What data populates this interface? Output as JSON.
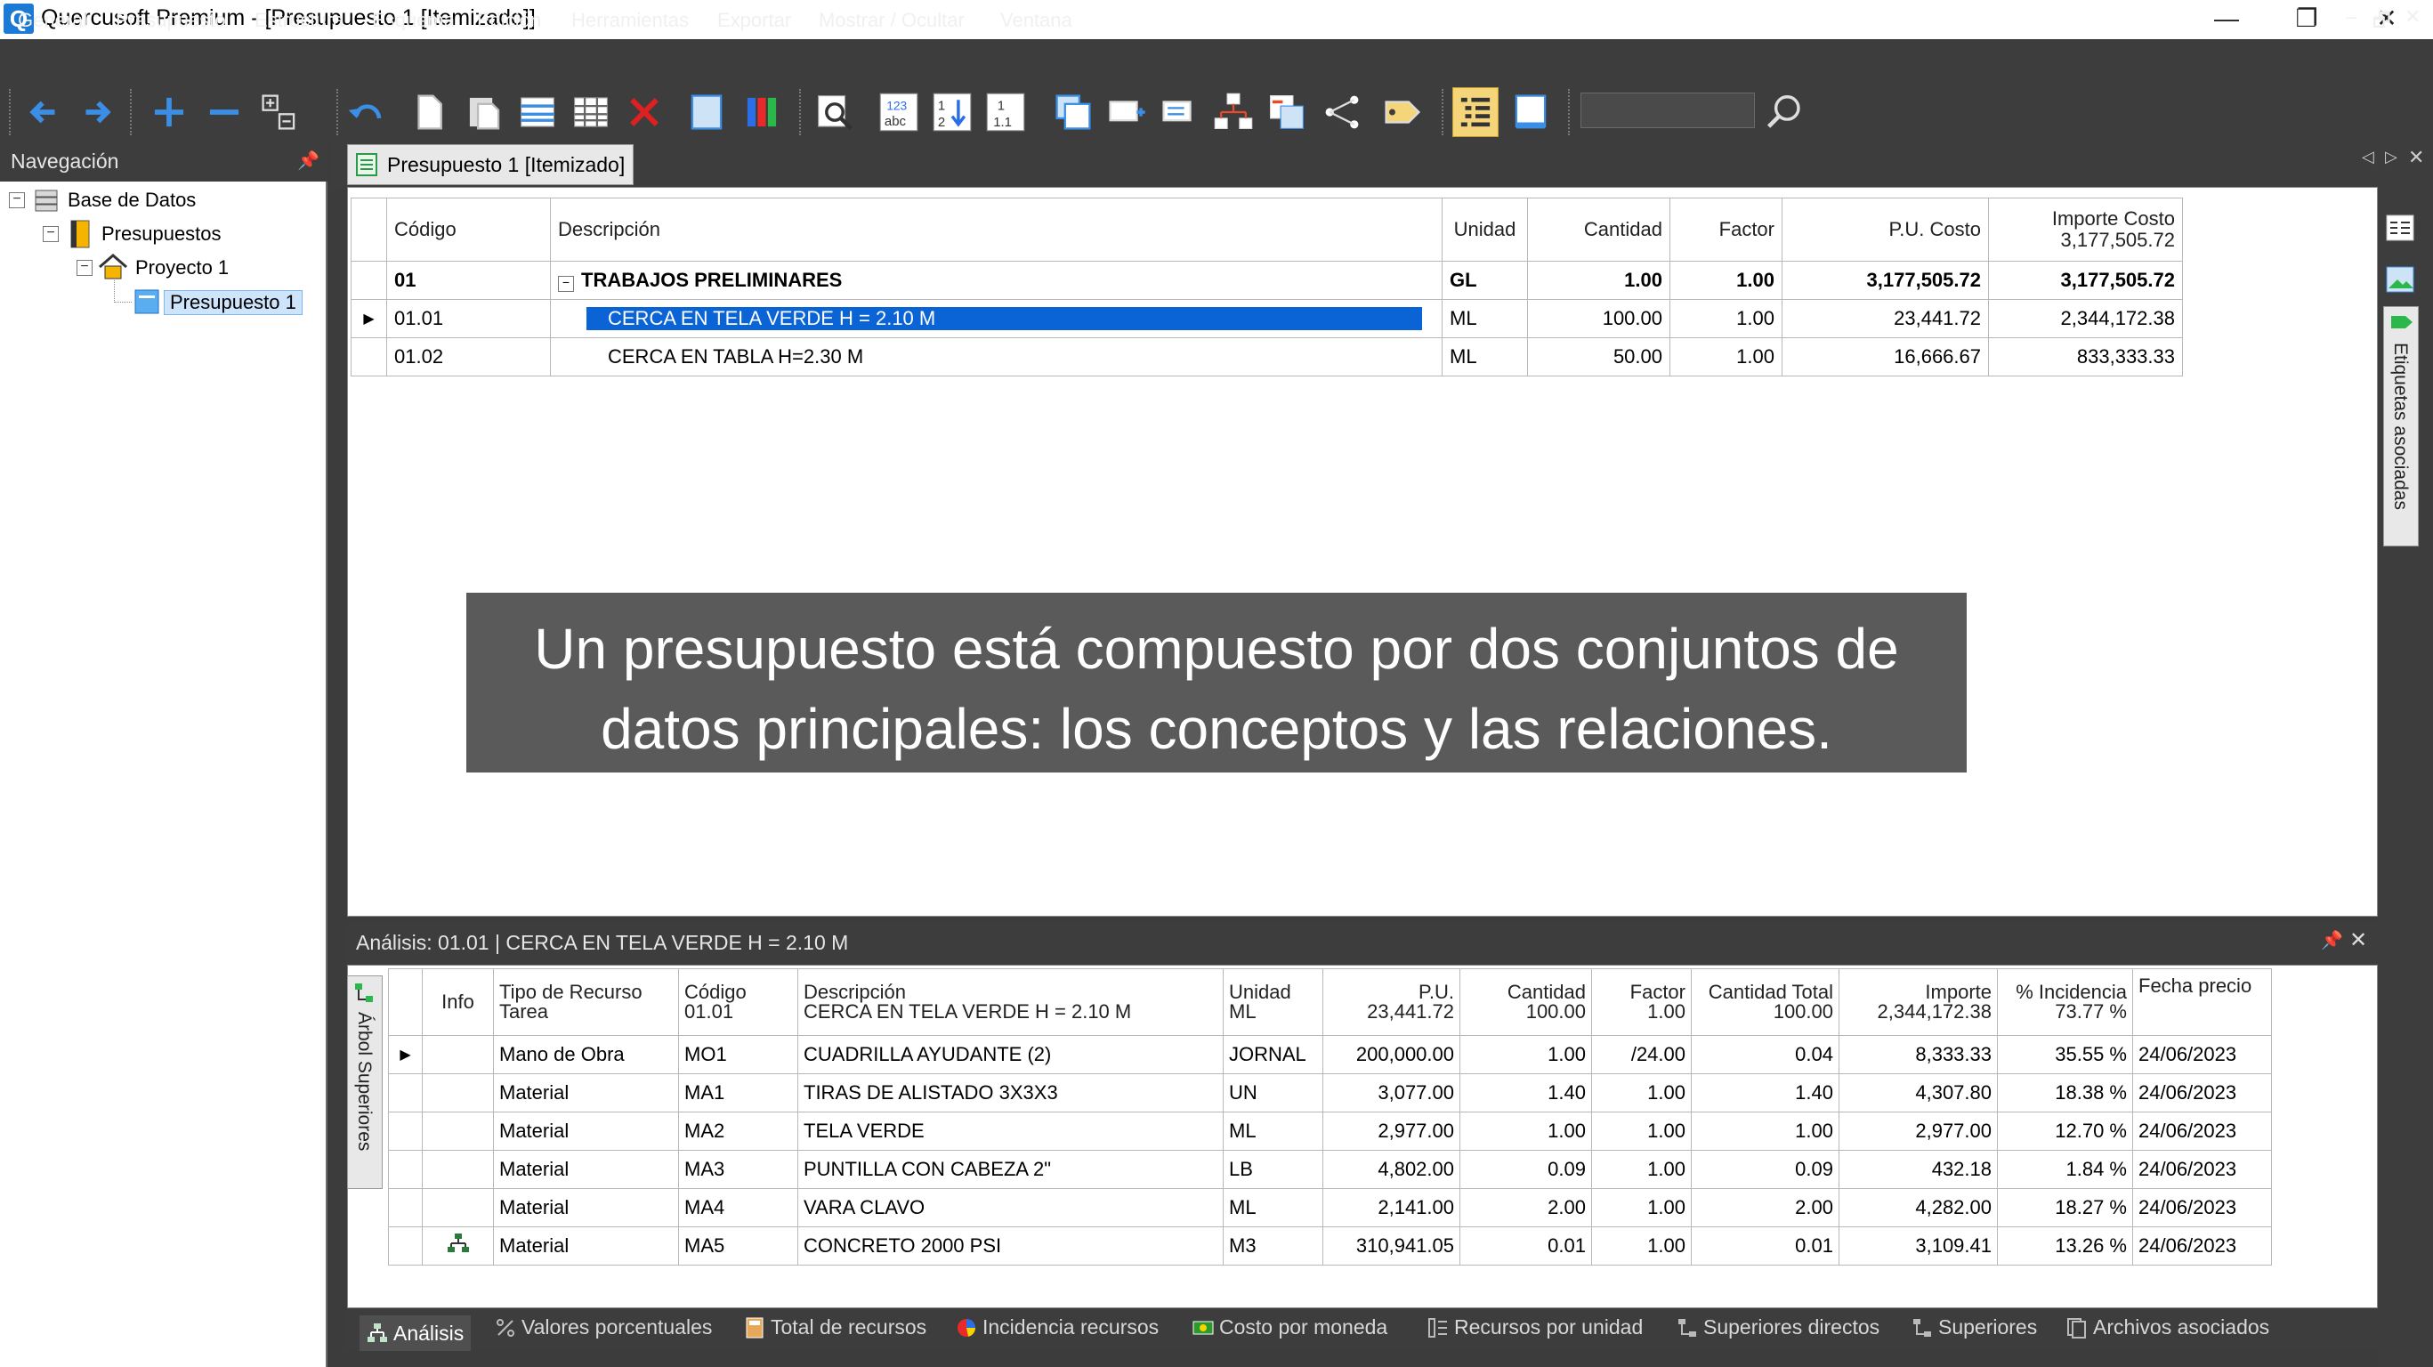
{
  "window": {
    "title": "Quercusoft Premium - [Presupuesto 1 [Itemizado]]",
    "icon_letter": "Q",
    "min": "—",
    "restore": "❐",
    "close": "✕"
  },
  "menu": [
    "General",
    "Presupuesto",
    "Estructura",
    "Esquema",
    "Edición",
    "Herramientas",
    "Exportar",
    "Mostrar / Ocultar",
    "Ventana"
  ],
  "mdi": {
    "min": "–",
    "restore": "🗗",
    "close": "✕"
  },
  "toolbar": {
    "buttons": [
      "back-icon",
      "forward-icon",
      "add-icon",
      "remove-icon",
      "add-child-icon",
      "undo-icon",
      "copy-icon",
      "paste-icon",
      "insert-rows-icon",
      "grid-icon",
      "delete-icon",
      "blank-icon",
      "columns-icon",
      "zoom-icon",
      "spell-icon",
      "sort-icon",
      "number-icon",
      "window-icon",
      "link-icon",
      "list-icon",
      "tree-icon",
      "export-icon",
      "share-icon",
      "tag-icon",
      "outline-icon",
      "layout-icon",
      "search-icon"
    ],
    "search_value": ""
  },
  "nav": {
    "title": "Navegación",
    "pin": "📌",
    "tree": [
      {
        "label": "Base de Datos",
        "icon": "database-icon",
        "level": 0
      },
      {
        "label": "Presupuestos",
        "icon": "folder-icon",
        "level": 1
      },
      {
        "label": "Proyecto 1",
        "icon": "house-icon",
        "level": 2
      },
      {
        "label": "Presupuesto 1",
        "icon": "budget-icon",
        "level": 3,
        "selected": true
      }
    ]
  },
  "doc_tab": {
    "label": "Presupuesto 1 [Itemizado]"
  },
  "grid": {
    "columns": [
      "Código",
      "Descripción",
      "Unidad",
      "Cantidad",
      "Factor",
      "P.U. Costo",
      "Importe Costo"
    ],
    "importe_total": "3,177,505.72",
    "rows": [
      {
        "codigo": "01",
        "descripcion": "TRABAJOS PRELIMINARES",
        "unidad": "GL",
        "cantidad": "1.00",
        "factor": "1.00",
        "pu": "3,177,505.72",
        "importe": "3,177,505.72"
      },
      {
        "codigo": "01.01",
        "descripcion": "CERCA EN TELA VERDE H = 2.10 M",
        "unidad": "ML",
        "cantidad": "100.00",
        "factor": "1.00",
        "pu": "23,441.72",
        "importe": "2,344,172.38"
      },
      {
        "codigo": "01.02",
        "descripcion": "CERCA EN TABLA H=2.30 M",
        "unidad": "ML",
        "cantidad": "50.00",
        "factor": "1.00",
        "pu": "16,666.67",
        "importe": "833,333.33"
      }
    ]
  },
  "caption": {
    "line1": "Un presupuesto está compuesto por dos conjuntos de",
    "line2": "datos principales: los conceptos y las relaciones."
  },
  "analysis": {
    "title": "Análisis: 01.01 | CERCA EN TELA VERDE H = 2.10 M",
    "side_tab": "Árbol Superiores",
    "header": {
      "info": "Info",
      "tipo": "Tipo de Recurso",
      "tipo_sub": "Tarea",
      "codigo": "Código",
      "codigo_sub": "01.01",
      "descripcion": "Descripción",
      "descripcion_sub": "CERCA EN TELA VERDE H = 2.10 M",
      "unidad": "Unidad",
      "unidad_sub": "ML",
      "pu": "P.U.",
      "pu_sub": "23,441.72",
      "cantidad": "Cantidad",
      "cantidad_sub": "100.00",
      "factor": "Factor",
      "factor_sub": "1.00",
      "cant_total": "Cantidad Total",
      "cant_total_sub": "100.00",
      "importe": "Importe",
      "importe_sub": "2,344,172.38",
      "incidencia": "% Incidencia",
      "incidencia_sub": "73.77 %",
      "fecha": "Fecha precio"
    },
    "rows": [
      {
        "tipo": "Mano de Obra",
        "codigo": "MO1",
        "descripcion": "CUADRILLA AYUDANTE (2)",
        "unidad": "JORNAL",
        "pu": "200,000.00",
        "cantidad": "1.00",
        "factor": "/24.00",
        "cant_total": "0.04",
        "importe": "8,333.33",
        "incidencia": "35.55 %",
        "fecha": "24/06/2023"
      },
      {
        "tipo": "Material",
        "codigo": "MA1",
        "descripcion": "TIRAS DE ALISTADO 3X3X3",
        "unidad": "UN",
        "pu": "3,077.00",
        "cantidad": "1.40",
        "factor": "1.00",
        "cant_total": "1.40",
        "importe": "4,307.80",
        "incidencia": "18.38 %",
        "fecha": "24/06/2023"
      },
      {
        "tipo": "Material",
        "codigo": "MA2",
        "descripcion": "TELA VERDE",
        "unidad": "ML",
        "pu": "2,977.00",
        "cantidad": "1.00",
        "factor": "1.00",
        "cant_total": "1.00",
        "importe": "2,977.00",
        "incidencia": "12.70 %",
        "fecha": "24/06/2023"
      },
      {
        "tipo": "Material",
        "codigo": "MA3",
        "descripcion": "PUNTILLA CON CABEZA 2\"",
        "unidad": "LB",
        "pu": "4,802.00",
        "cantidad": "0.09",
        "factor": "1.00",
        "cant_total": "0.09",
        "importe": "432.18",
        "incidencia": "1.84 %",
        "fecha": "24/06/2023"
      },
      {
        "tipo": "Material",
        "codigo": "MA4",
        "descripcion": "VARA CLAVO",
        "unidad": "ML",
        "pu": "2,141.00",
        "cantidad": "2.00",
        "factor": "1.00",
        "cant_total": "2.00",
        "importe": "4,282.00",
        "incidencia": "18.27 %",
        "fecha": "24/06/2023"
      },
      {
        "tipo": "Material",
        "codigo": "MA5",
        "descripcion": "CONCRETO 2000 PSI",
        "unidad": "M3",
        "pu": "310,941.05",
        "cantidad": "0.01",
        "factor": "1.00",
        "cant_total": "0.01",
        "importe": "3,109.41",
        "incidencia": "13.26 %",
        "fecha": "24/06/2023",
        "info_icon": "hierarchy-icon"
      }
    ]
  },
  "right_strip": {
    "etiquetas": "Etiquetas asociadas"
  },
  "bottom_tabs": [
    "Análisis",
    "Valores porcentuales",
    "Total de recursos",
    "Incidencia recursos",
    "Costo por moneda",
    "Recursos por unidad",
    "Superiores directos",
    "Superiores",
    "Archivos asociados"
  ],
  "colors": {
    "accent": "#0a64d6",
    "panel_dark": "#3d3d3d",
    "caption_bg": "#5a5a5a"
  }
}
